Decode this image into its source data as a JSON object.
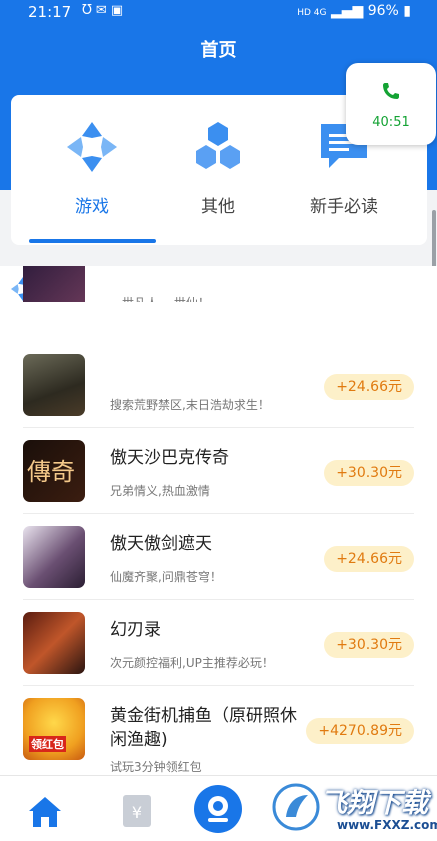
{
  "status_bar": {
    "time": "21:17",
    "network": "HD 4G",
    "battery": "96%"
  },
  "header": {
    "title": "首页"
  },
  "categories": [
    {
      "label": "游戏",
      "icon": "game-logo-icon",
      "active": true
    },
    {
      "label": "其他",
      "icon": "hexagons-icon",
      "active": false
    },
    {
      "label": "新手必读",
      "icon": "message-icon",
      "active": false
    }
  ],
  "timer": {
    "icon": "phone-icon",
    "value": "40:51"
  },
  "section": {
    "title": "游戏"
  },
  "partial_item": {
    "desc": "一世凡人,一世仙！"
  },
  "games": [
    {
      "name": "",
      "desc": "搜索荒野禁区,末日浩劫求生！",
      "reward": "+24.66元"
    },
    {
      "name": "傲天沙巴克传奇",
      "desc": "兄弟情义,热血激情",
      "reward": "+30.30元"
    },
    {
      "name": "傲天傲剑遮天",
      "desc": "仙魔齐聚,问鼎苍穹！",
      "reward": "+24.66元"
    },
    {
      "name": "幻刃录",
      "desc": "次元颜控福利,UP主推荐必玩！",
      "reward": "+30.30元"
    },
    {
      "name": "黄金街机捕鱼（原研照休闲渔趣)",
      "desc": "试玩3分钟领红包",
      "reward": "+4270.89元"
    }
  ],
  "thumb_labels": {
    "chuanqi": "傳奇",
    "fish": "领红包"
  },
  "bottom_nav": [
    {
      "label": "home",
      "icon": "home-icon"
    },
    {
      "label": "rewards",
      "icon": "yuan-card-icon"
    },
    {
      "label": "profile",
      "icon": "profile-icon"
    }
  ],
  "watermark": {
    "title": "飞翔下载",
    "url": "www.FXXZ.com"
  },
  "colors": {
    "primary": "#1976e8",
    "reward_text": "#e07a10",
    "reward_bg": "#fdf0c9",
    "timer_green": "#14a334"
  }
}
